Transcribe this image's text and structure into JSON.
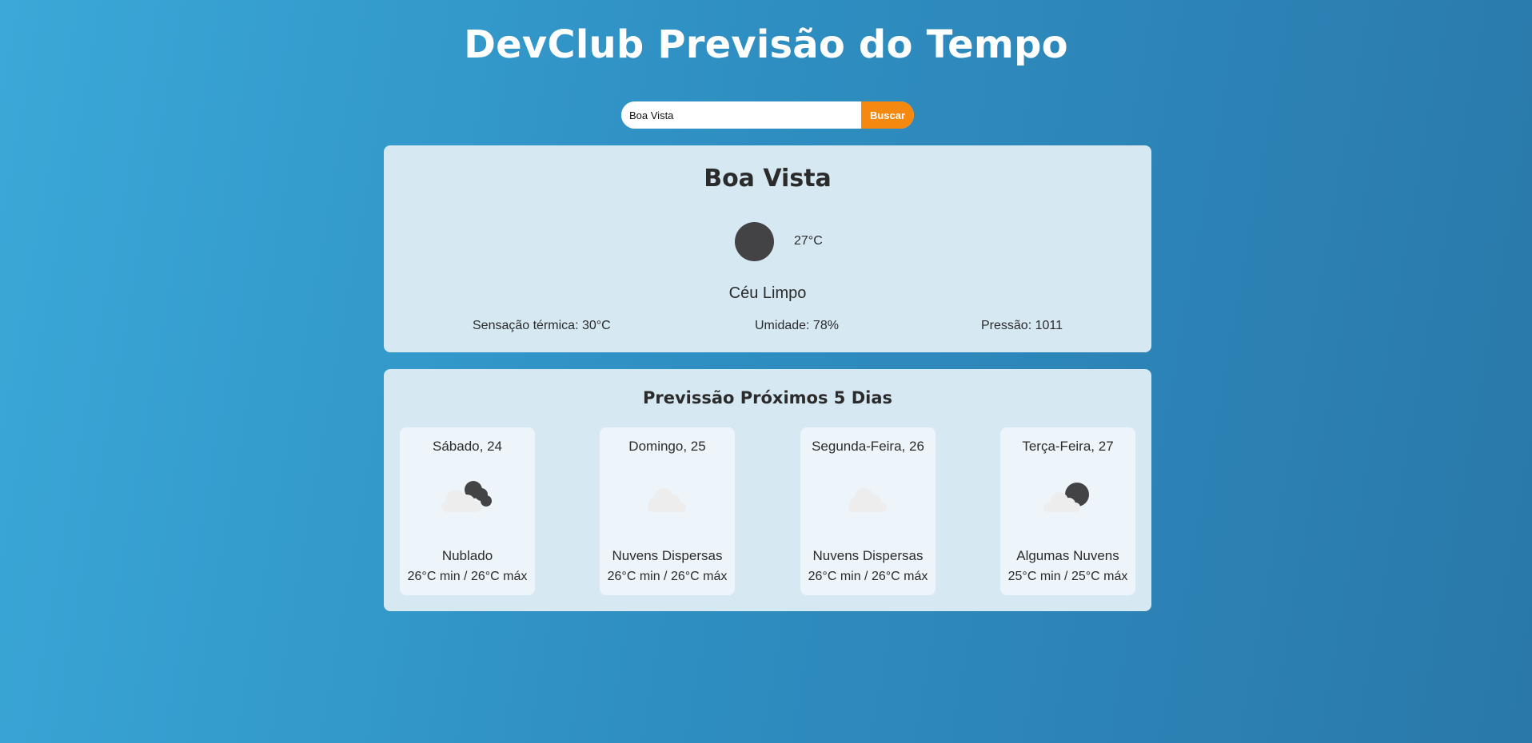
{
  "app": {
    "title": "DevClub Previsão do Tempo"
  },
  "search": {
    "value": "Boa Vista",
    "placeholder": "",
    "button_label": "Buscar"
  },
  "current": {
    "city": "Boa Vista",
    "temperature": "27°C",
    "description": "Céu Limpo",
    "icon": "clear-night-icon",
    "feels_like": "Sensação térmica: 30°C",
    "humidity": "Umidade: 78%",
    "pressure": "Pressão: 1011"
  },
  "forecast": {
    "title": "Previssão Próximos 5 Dias",
    "days": [
      {
        "day": "Sábado, 24",
        "description": "Nublado",
        "temps": "26°C min / 26°C máx",
        "icon": "broken-clouds-icon"
      },
      {
        "day": "Domingo, 25",
        "description": "Nuvens Dispersas",
        "temps": "26°C min / 26°C máx",
        "icon": "scattered-clouds-icon"
      },
      {
        "day": "Segunda-Feira, 26",
        "description": "Nuvens Dispersas",
        "temps": "26°C min / 26°C máx",
        "icon": "scattered-clouds-icon"
      },
      {
        "day": "Terça-Feira, 27",
        "description": "Algumas Nuvens",
        "temps": "25°C min / 25°C máx",
        "icon": "few-clouds-night-icon"
      }
    ]
  },
  "colors": {
    "accent": "#f5890f",
    "card_bg": "#d6e8f2",
    "day_card_bg": "#eef5fa",
    "moon": "#434245",
    "cloud": "#ededed"
  }
}
